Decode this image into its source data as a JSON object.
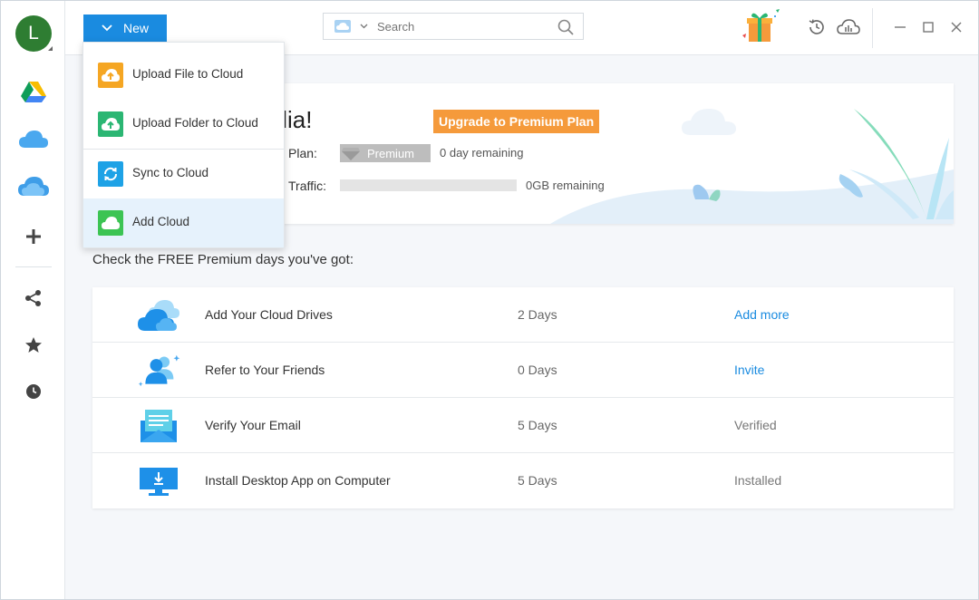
{
  "user": {
    "initial": "L"
  },
  "topbar": {
    "new_label": "New",
    "search_placeholder": "Search"
  },
  "dropdown": {
    "items": [
      {
        "label": "Upload File to Cloud",
        "icon": "upload-file-icon",
        "color": "#f5a623"
      },
      {
        "label": "Upload Folder to Cloud",
        "icon": "upload-folder-icon",
        "color": "#2bb673"
      },
      {
        "label": "Sync to Cloud",
        "icon": "sync-icon",
        "color": "#1ea2e6"
      },
      {
        "label": "Add Cloud",
        "icon": "add-cloud-icon",
        "color": "#3cc453"
      }
    ]
  },
  "banner": {
    "welcome": "come, Lydia!",
    "upgrade_label": "Upgrade to Premium Plan",
    "plan_label": "Plan:",
    "plan_value": "Premium",
    "plan_remaining": "0 day remaining",
    "traffic_label": "Traffic:",
    "traffic_remaining": "0GB remaining",
    "traffic_used_fraction": 0
  },
  "free_section": {
    "title": "Check the FREE Premium days you've got:",
    "rows": [
      {
        "name": "Add Your Cloud Drives",
        "days": "2 Days",
        "action": "Add more",
        "link": true,
        "icon": "cloud-drives-icon"
      },
      {
        "name": "Refer to Your Friends",
        "days": "0 Days",
        "action": "Invite",
        "link": true,
        "icon": "friends-icon"
      },
      {
        "name": "Verify Your Email",
        "days": "5 Days",
        "action": "Verified",
        "link": false,
        "icon": "email-icon"
      },
      {
        "name": "Install Desktop App on Computer",
        "days": "5 Days",
        "action": "Installed",
        "link": false,
        "icon": "desktop-icon"
      }
    ]
  },
  "colors": {
    "accent": "#1a8be0",
    "upgrade": "#f59a3b",
    "avatar": "#2e7d32"
  }
}
